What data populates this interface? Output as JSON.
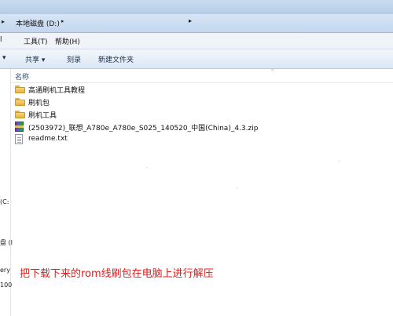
{
  "address_bar": {
    "back_arrow": "▸",
    "path": "本地磁盘 (D:)",
    "separator": "▸",
    "dropdown": "▸"
  },
  "menu": {
    "edge_item": "l",
    "tools": "工具(T)",
    "help": "帮助(H)"
  },
  "toolbar": {
    "edge_item": "▾",
    "share": "共享 ▾",
    "burn": "刻录",
    "new_folder": "新建文件夹"
  },
  "nav_pane": {
    "fragment_1": "(C:",
    "fragment_2": "盘 (I",
    "fragment_3": "ery",
    "fragment_4": "100"
  },
  "file_list": {
    "column_name": "名称",
    "sort_arrow": "^",
    "items": [
      {
        "name": "高通刷机工具教程",
        "type": "folder",
        "icon": "folder-icon"
      },
      {
        "name": "刷机包",
        "type": "folder",
        "icon": "folder-icon"
      },
      {
        "name": "刷机工具",
        "type": "folder",
        "icon": "folder-icon"
      },
      {
        "name": "(2503972)_联想_A780e_A780e_S025_140520_中国(China)_4.3.zip",
        "type": "zip",
        "icon": "winrar-archive-icon"
      },
      {
        "name": "readme.txt",
        "type": "text",
        "icon": "text-file-icon"
      }
    ]
  },
  "caption": "把下载下来的rom线刷包在电脑上进行解压",
  "colors": {
    "caption": "#e21c1c",
    "toolbar_bg": "#dae6f4",
    "folder": "#f8d67a"
  }
}
